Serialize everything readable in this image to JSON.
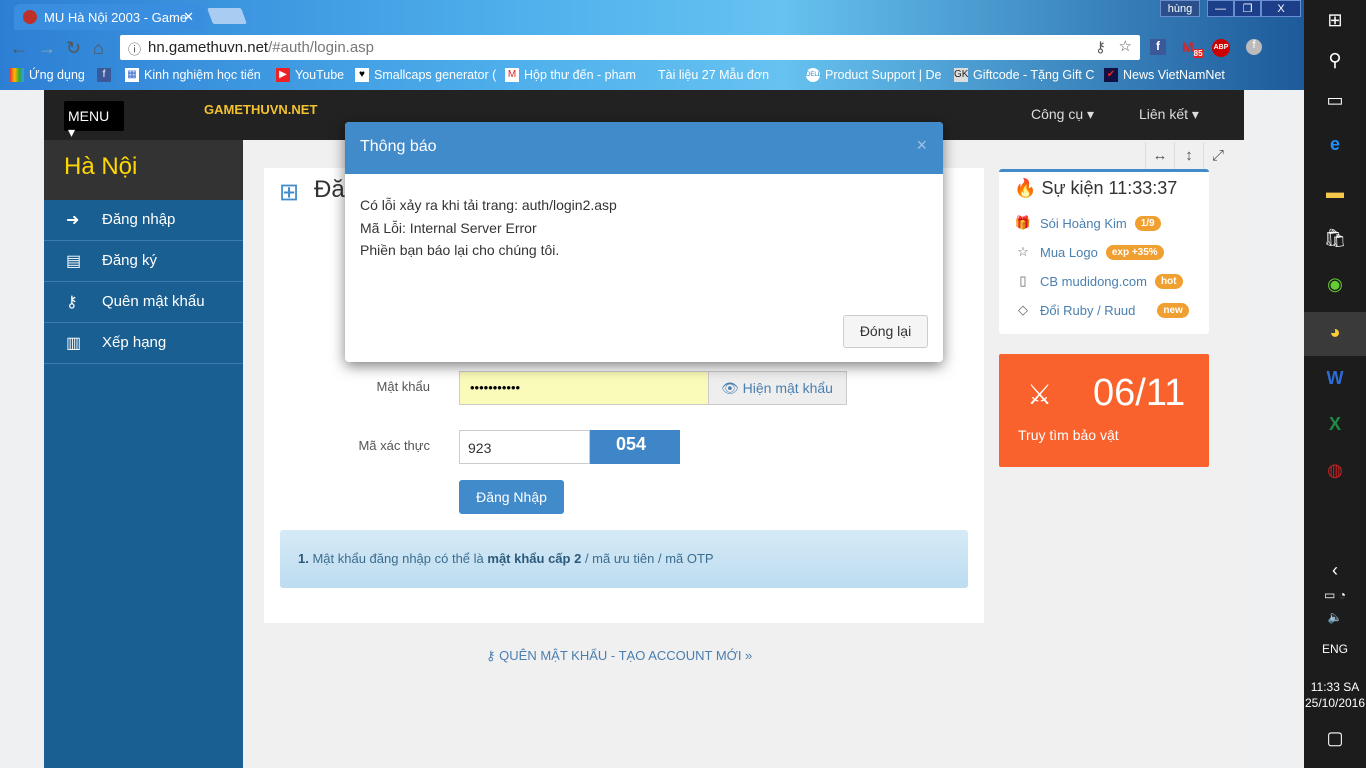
{
  "browser": {
    "tab_title": "MU Hà Nội 2003 - Game",
    "url_host": "hn.gamethuvn.net",
    "url_path": "/#auth/login.asp",
    "profile": "hùng",
    "gmail_count": "85",
    "bookmarks": [
      "Ứng dụng",
      "Kinh nghiệm học tiến",
      "YouTube",
      "Smallcaps generator (",
      "Hộp thư đến - pham",
      "Tài liệu 27 Mẫu đơn",
      "Product Support | De",
      "Giftcode - Tặng Gift C",
      "News VietNamNet"
    ]
  },
  "header": {
    "menu": "MENU",
    "logo": "GAMETHUVN.NET",
    "logo_bg": "MU",
    "nav": [
      "Công cụ",
      "Liên kết"
    ]
  },
  "sidebar": {
    "city": "Hà Nội",
    "items": [
      {
        "label": "Đăng nhập",
        "icon": "sign-in-icon"
      },
      {
        "label": "Đăng ký",
        "icon": "file-icon"
      },
      {
        "label": "Quên mật khẩu",
        "icon": "key-icon"
      },
      {
        "label": "Xếp hạng",
        "icon": "bar-chart-icon"
      }
    ]
  },
  "main": {
    "title": "Đăng nhập",
    "password_label": "Mật khẩu",
    "password_value": "•••••••••••",
    "show_password": "Hiện mật khẩu",
    "captcha_label": "Mã xác thực",
    "captcha_value": "923",
    "captcha_image": "054",
    "login_button": "Đăng Nhập",
    "note_num": "1.",
    "note_pre": "Mật khẩu đăng nhập có thể là",
    "note_bold": "mật khẩu cấp 2",
    "note_post": "/ mã ưu tiên / mã OTP",
    "footer_link": "QUÊN MẬT KHẨU - TẠO ACCOUNT MỚI »"
  },
  "events": {
    "title": "Sự kiện 11:33:37",
    "items": [
      {
        "label": "Sói Hoàng Kim",
        "badge": "1/9"
      },
      {
        "label": "Mua Logo",
        "badge": "exp +35%"
      },
      {
        "label": "CB mudidong.com",
        "badge": "hot"
      },
      {
        "label": "Đổi Ruby / Ruud",
        "badge": "new"
      }
    ]
  },
  "hunt": {
    "date": "06/11",
    "label": "Truy tìm bảo vật",
    "color": "#f9622c"
  },
  "modal": {
    "title": "Thông báo",
    "lines": [
      "Có lỗi xảy ra khi tải trang: auth/login2.asp",
      "Mã Lỗi: Internal Server Error",
      "Phiền bạn báo lại cho chúng tôi."
    ],
    "close_button": "Đóng lại"
  },
  "taskbar": {
    "lang": "ENG",
    "time": "11:33 SA",
    "date": "25/10/2016"
  }
}
